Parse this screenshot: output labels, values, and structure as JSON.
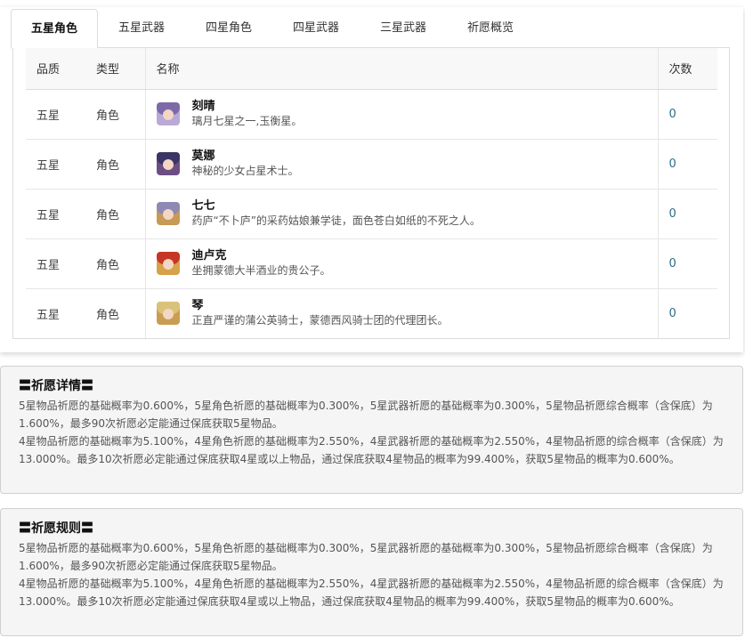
{
  "tabs": [
    {
      "label": "五星角色"
    },
    {
      "label": "五星武器"
    },
    {
      "label": "四星角色"
    },
    {
      "label": "四星武器"
    },
    {
      "label": "三星武器"
    },
    {
      "label": "祈愿概览"
    }
  ],
  "table": {
    "headers": [
      "品质",
      "类型",
      "名称",
      "次数"
    ],
    "rows": [
      {
        "quality": "五星",
        "type": "角色",
        "name": "刻晴",
        "desc": "璃月七星之一,玉衡星。",
        "count": "0",
        "avatar": "keqing-portrait",
        "hair": "#7c6aa8",
        "bg": "#b9a9d6"
      },
      {
        "quality": "五星",
        "type": "角色",
        "name": "莫娜",
        "desc": "神秘的少女占星术士。",
        "count": "0",
        "avatar": "mona-portrait",
        "hair": "#3b3466",
        "bg": "#6d4e84"
      },
      {
        "quality": "五星",
        "type": "角色",
        "name": "七七",
        "desc": "药庐“不卜庐”的采药姑娘兼学徒，面色苍白如纸的不死之人。",
        "count": "0",
        "avatar": "qiqi-portrait",
        "hair": "#8e8ab4",
        "bg": "#c79a56"
      },
      {
        "quality": "五星",
        "type": "角色",
        "name": "迪卢克",
        "desc": "坐拥蒙德大半酒业的贵公子。",
        "count": "0",
        "avatar": "diluc-portrait",
        "hair": "#c63626",
        "bg": "#d6a24a"
      },
      {
        "quality": "五星",
        "type": "角色",
        "name": "琴",
        "desc": "正直严谨的蒲公英骑士，蒙德西风骑士团的代理团长。",
        "count": "0",
        "avatar": "jean-portrait",
        "hair": "#d9c27a",
        "bg": "#c99d52"
      }
    ]
  },
  "details": {
    "title": "〓祈愿详情〓",
    "p1": "5星物品祈愿的基础概率为0.600%，5星角色祈愿的基础概率为0.300%，5星武器祈愿的基础概率为0.300%，5星物品祈愿综合概率（含保底）为1.600%，最多90次祈愿必定能通过保底获取5星物品。",
    "p2": "4星物品祈愿的基础概率为5.100%，4星角色祈愿的基础概率为2.550%，4星武器祈愿的基础概率为2.550%，4星物品祈愿的综合概率（含保底）为13.000%。最多10次祈愿必定能通过保底获取4星或以上物品，通过保底获取4星物品的概率为99.400%，获取5星物品的概率为0.600%。"
  },
  "rules": {
    "title": "〓祈愿规则〓",
    "p1": "5星物品祈愿的基础概率为0.600%，5星角色祈愿的基础概率为0.300%，5星武器祈愿的基础概率为0.300%，5星物品祈愿综合概率（含保底）为1.600%，最多90次祈愿必定能通过保底获取5星物品。",
    "p2": "4星物品祈愿的基础概率为5.100%，4星角色祈愿的基础概率为2.550%，4星武器祈愿的基础概率为2.550%，4星物品祈愿的综合概率（含保底）为13.000%。最多10次祈愿必定能通过保底获取4星或以上物品，通过保底获取4星物品的概率为99.400%，获取5星物品的概率为0.600%。"
  }
}
